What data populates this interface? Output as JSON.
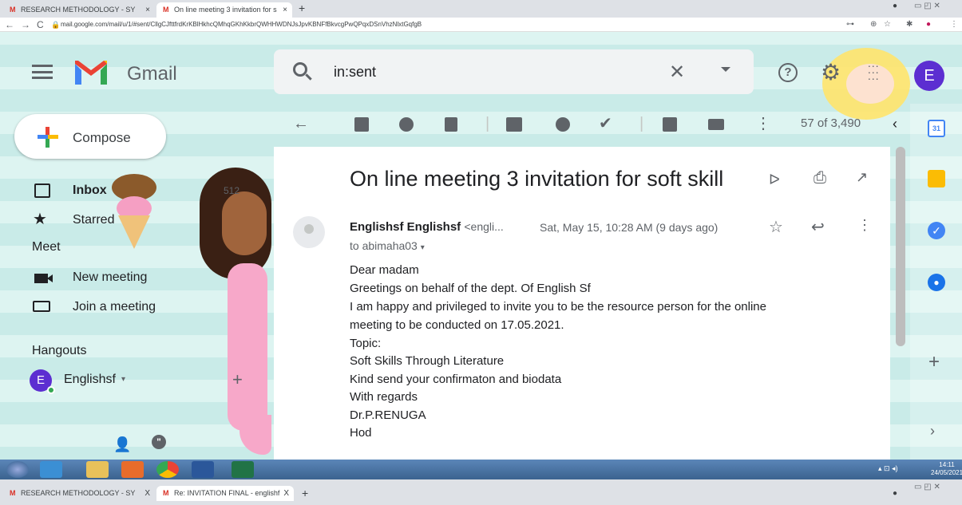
{
  "browser": {
    "tabs": [
      {
        "label": "RESEARCH METHODOLOGY - SY",
        "close": "×"
      },
      {
        "label": "On line meeting 3 invitation for s",
        "close": "×"
      }
    ],
    "new_tab": "+",
    "url": "mail.google.com/mail/u/1/#sent/CllgCJfttfrdKrKBlHkhcQMhqGKhKkbrQWHHWDNJsJpvKBNFfBkvcgPwQPqxDSnVhzNlxtGqfgB",
    "window_controls": "▭ ◰ ✕"
  },
  "gmail": {
    "logo_text": "Gmail",
    "search_value": "in:sent",
    "avatar_letter": "E"
  },
  "sidebar": {
    "compose": "Compose",
    "inbox": "Inbox",
    "inbox_count": "512",
    "starred": "Starred",
    "meet_header": "Meet",
    "new_meeting": "New meeting",
    "join_meeting": "Join a meeting",
    "hangouts_header": "Hangouts",
    "hangouts_user": "Englishsf",
    "hangouts_letter": "E",
    "hangouts_plus": "+"
  },
  "toolbar": {
    "count": "57 of 3,490"
  },
  "message": {
    "subject": "On line meeting 3 invitation for soft skill",
    "sender_name": "Englishsf Englishsf",
    "sender_email": "<engli...",
    "date": "Sat, May 15, 10:28 AM (9 days ago)",
    "to": "to abimaha03",
    "body": [
      "Dear madam",
      "Greetings on behalf of the dept. Of English Sf",
      "I am happy and privileged to invite you to be the resource person for the online",
      "meeting to be conducted  on 17.05.2021.",
      "Topic:",
      "Soft Skills Through Literature",
      "Kind send your confirmaton and biodata",
      "With regards",
      "Dr.P.RENUGA",
      "Hod"
    ]
  },
  "side_panel": {
    "calendar_day": "31",
    "plus": "+"
  },
  "taskbar": {
    "time": "14:11",
    "date": "24/05/2021"
  },
  "bottom_tabs": [
    {
      "label": "RESEARCH METHODOLOGY - SY",
      "close": "X"
    },
    {
      "label": "Re: INVITATION FINAL - englishf",
      "close": "X"
    }
  ],
  "colors": {
    "gmail_red": "#d93025",
    "avatar": "#5c2ed1",
    "accent_blue": "#4285f4"
  }
}
